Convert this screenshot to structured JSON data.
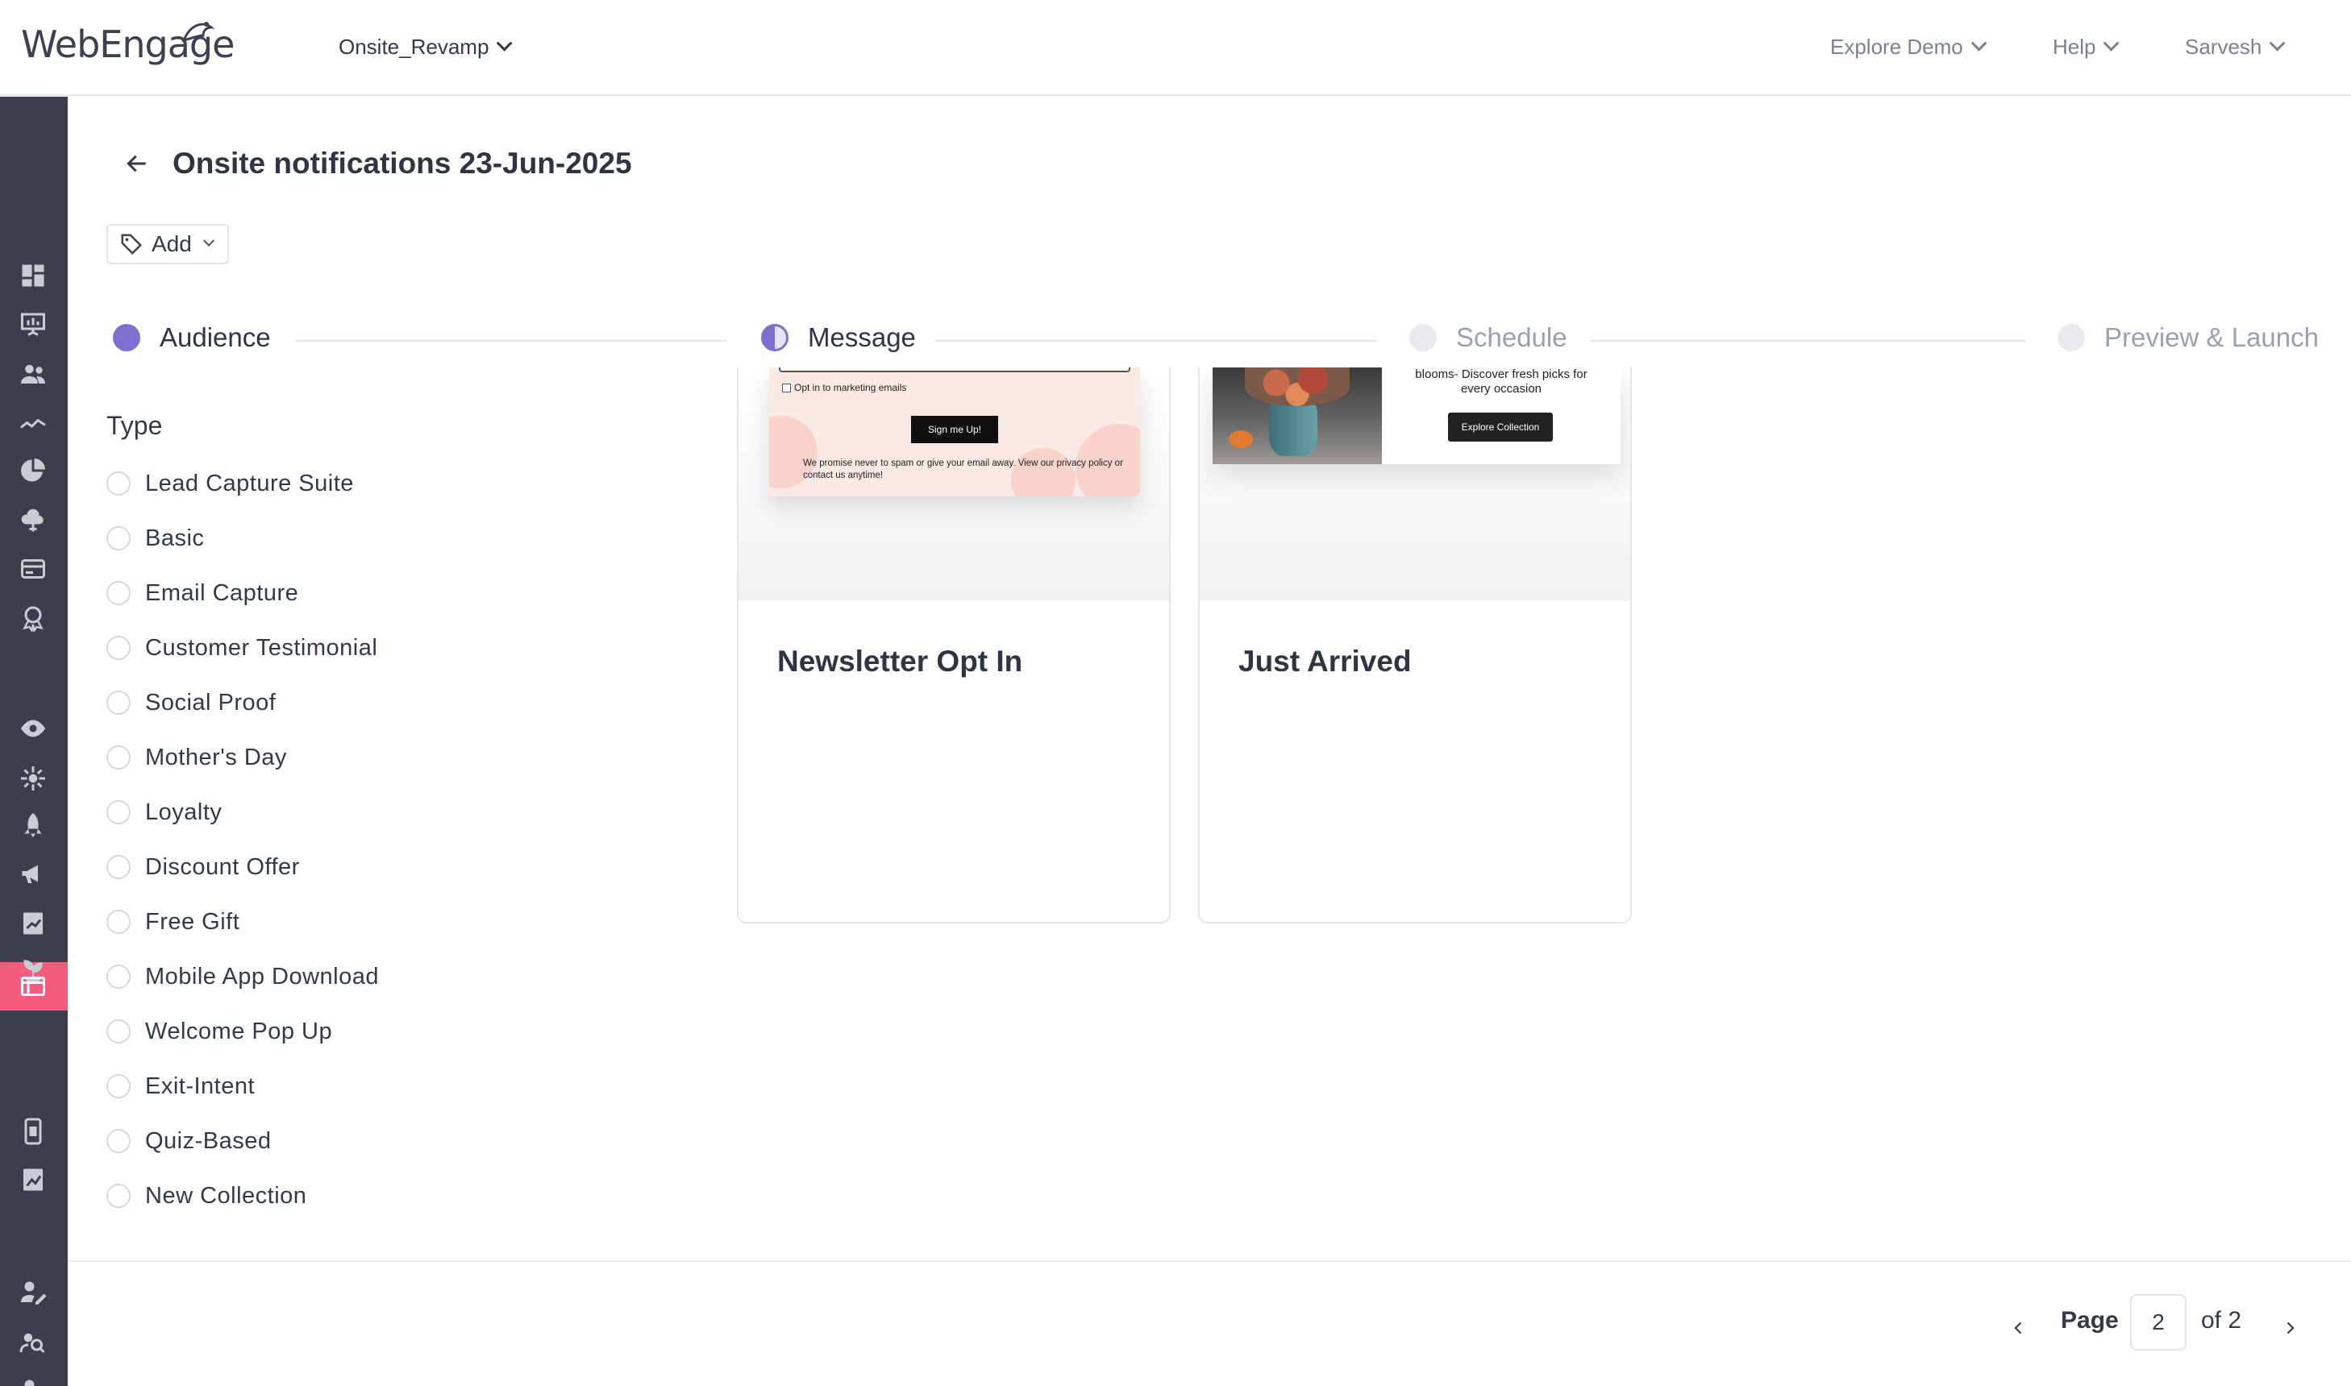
{
  "brand": {
    "name_part1": "Web",
    "name_part2": "Engage"
  },
  "header": {
    "project": "Onsite_Revamp",
    "explore_demo": "Explore Demo",
    "help": "Help",
    "user": "Sarvesh"
  },
  "sidebar": {
    "icons": [
      "dashboard-icon",
      "presentation-icon",
      "users-icon",
      "trends-icon",
      "pie-chart-icon",
      "cloud-upload-icon",
      "cards-icon",
      "badge-icon",
      "eye-icon",
      "sparkle-icon",
      "rocket-icon",
      "megaphone-icon",
      "report-icon",
      "plant-icon",
      "onsite-icon",
      "mobile-icon",
      "analytics-icon",
      "user-edit-icon",
      "user-search-icon",
      "user-settings-icon",
      "info-icon"
    ],
    "active": "onsite-icon"
  },
  "page": {
    "title": "Onsite notifications 23-Jun-2025",
    "tag_button": "Add"
  },
  "stepper": {
    "steps": [
      {
        "label": "Audience",
        "state": "complete"
      },
      {
        "label": "Message",
        "state": "in-progress"
      },
      {
        "label": "Schedule",
        "state": "pending"
      },
      {
        "label": "Preview & Launch",
        "state": "pending"
      }
    ]
  },
  "filter": {
    "heading": "Type",
    "options": [
      "Lead Capture Suite",
      "Basic",
      "Email Capture",
      "Customer Testimonial",
      "Social Proof",
      "Mother's Day",
      "Loyalty",
      "Discount Offer",
      "Free Gift",
      "Mobile App Download",
      "Welcome Pop Up",
      "Exit-Intent",
      "Quiz-Based",
      "New Collection"
    ]
  },
  "templates": [
    {
      "title": "Newsletter Opt In",
      "preview": {
        "checkbox_label": "Opt in to marketing emails",
        "button": "Sign me Up!",
        "note": "We promise never to spam or give your email away. View our privacy policy or contact us anytime!"
      }
    },
    {
      "title": "Just Arrived",
      "preview": {
        "text": "blooms- Discover fresh picks for every occasion",
        "button": "Explore Collection"
      }
    }
  ],
  "pagination": {
    "label": "Page",
    "current": "2",
    "of_text": "of 2"
  },
  "colors": {
    "accent_purple": "#7f6fcf",
    "sidebar_bg": "#3a3f4b",
    "sidebar_active": "#f45c7d"
  }
}
